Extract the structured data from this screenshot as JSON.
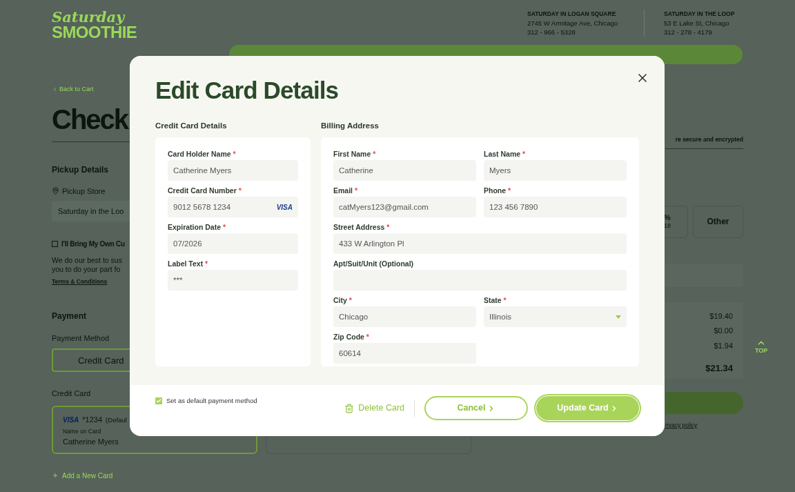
{
  "header": {
    "logo_top": "Saturday",
    "logo_bottom": "SMOOTHIE",
    "stores": [
      {
        "name": "SATURDAY IN LOGAN SQUARE",
        "address": "2745 W Armitage Ave, Chicago",
        "phone": "312 - 966 - 5328"
      },
      {
        "name": "SATURDAY IN THE LOOP",
        "address": "53 E Lake St, Chicago",
        "phone": "312 - 278 - 4179"
      }
    ]
  },
  "page": {
    "back_link": "Back to Cart",
    "title": "Check",
    "pickup_heading": "Pickup Details",
    "pickup_store_label": "Pickup Store",
    "pickup_store_value": "Saturday in the Loo",
    "own_cup": {
      "label": "I'll Bring My Own Cu",
      "checked": false
    },
    "own_cup_text": [
      "We do our best to sus",
      "you to do your part fo"
    ],
    "terms_link": "Terms & Conditions",
    "payment_heading": "Payment",
    "payment_method_label": "Payment Method",
    "payment_methods": [
      {
        "label": "Credit Card",
        "selected": true
      }
    ],
    "credit_card_label": "Credit Card",
    "saved_cards": [
      {
        "brand": "VISA",
        "number": "*1234",
        "tag": "(Defaul",
        "name_label": "Name on Card",
        "name": "Catherine Myers",
        "selected": true
      },
      {
        "selected": false
      }
    ],
    "add_card": "Add a New Card",
    "secure_note": "re secure and encrypted",
    "tip_options": [
      {
        "label": "%",
        "sub": "18",
        "selected": false
      },
      {
        "label": "Other",
        "selected": false
      }
    ],
    "summary": [
      "$19.40",
      "$0.00",
      "$1.94"
    ],
    "total": "$21.34",
    "privacy_link": "rivacy policy",
    "top_button": "TOP"
  },
  "modal": {
    "title": "Edit Card Details",
    "sections": [
      {
        "heading": "Credit Card Details",
        "field_groups": [
          [
            {
              "kind": "text",
              "wide": true,
              "label": "Card Holder Name",
              "mark": "*",
              "value": "Catherine Myers"
            }
          ],
          [
            {
              "kind": "card",
              "wide": true,
              "label": "Credit Card Number",
              "mark": "*",
              "value": "9012 5678 1234",
              "brand": "VISA"
            }
          ],
          [
            {
              "kind": "text",
              "wide": true,
              "label": "Expiration Date",
              "mark": "*",
              "value": "07/2026"
            }
          ],
          [
            {
              "kind": "text",
              "wide": true,
              "label": "Label Text",
              "mark": "*",
              "value": "***"
            }
          ]
        ]
      },
      {
        "heading": "Billing Address",
        "field_groups": [
          [
            {
              "kind": "text",
              "wide": false,
              "label": "First Name",
              "mark": "*",
              "value": "Catherine"
            },
            {
              "kind": "text",
              "wide": false,
              "label": "Last Name",
              "mark": "*",
              "value": "Myers"
            }
          ],
          [
            {
              "kind": "text",
              "wide": false,
              "label": "Email",
              "mark": "*",
              "value": "catMyers123@gmail.com"
            },
            {
              "kind": "text",
              "wide": false,
              "label": "Phone",
              "mark": "*",
              "value": "123 456 7890"
            }
          ],
          [
            {
              "kind": "text",
              "wide": true,
              "label": "Street Address",
              "mark": "*",
              "value": "433 W Arlington Pl"
            }
          ],
          [
            {
              "kind": "text",
              "wide": true,
              "label": "Apt/Suit/Unit (Optional)"
            }
          ],
          [
            {
              "kind": "text",
              "wide": false,
              "label": "City",
              "mark": "*",
              "value": "Chicago"
            },
            {
              "kind": "select",
              "wide": false,
              "label": "State",
              "mark": "*",
              "value": "Illinois"
            }
          ],
          [
            {
              "kind": "text",
              "wide": false,
              "label": "Zip Code",
              "mark": "*",
              "value": "60614"
            }
          ]
        ]
      }
    ],
    "default_checkbox": {
      "label": "Set as default payment method",
      "checked": true
    },
    "delete_button": "Delete Card",
    "cancel_button": "Cancel",
    "update_button": "Update Card"
  }
}
